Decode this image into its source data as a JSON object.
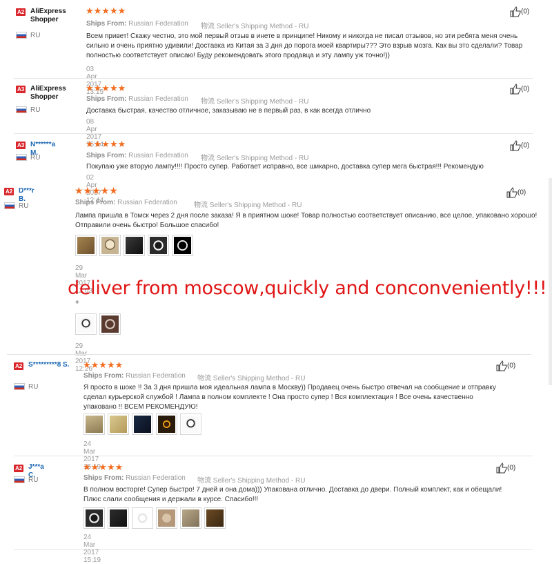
{
  "colors": {
    "badge": "#d9262c",
    "stars": "#f26b1d",
    "link": "#1a66b3",
    "overlay": "#e01616"
  },
  "ships_from_label": "Ships From:",
  "ship_icon_glyph": "物流",
  "method": "Seller's Shipping Method - RU",
  "overlay_text": "deliver from moscow,quickly and conconveniently!!!",
  "reviews": [
    {
      "badge": "A2",
      "name": "AliExpress Shopper",
      "country": "RU",
      "stars": "★★★★★",
      "ships": "Russian Federation",
      "text": "Всем привет! Скажу честно, это мой первый отзыв в инете в принципе! Никому и никогда не писал отзывов, но эти ребята меня очень сильно и очень приятно удивили! Доставка из Китая за 3 дня до порога моей квартиры??? Это взрыв мозга. Как вы это сделали? Товар полностью соответствует описаю! Буду рекомендовать этого продавца и эту лампу уж точно!))",
      "date": "03 Apr 2017 13:15",
      "helpful": "(0)"
    },
    {
      "badge": "A3",
      "name": "AliExpress Shopper",
      "country": "RU",
      "stars": "★★★★★",
      "ships": "Russian Federation",
      "text": "Доставка быстрая, качество отличное, заказываю не в первый раз, в как всегда отлично",
      "date": "08 Apr 2017 16:54",
      "helpful": "(0)"
    },
    {
      "badge": "A3",
      "name": "N******a M.",
      "country": "RU",
      "stars": "★★★★★",
      "ships": "Russian Federation",
      "text": "Покупаю уже вторую лампу!!!! Просто супер. Работает исправно, все шикарно, доставка супер мега быстрая!!! Рекомендую",
      "date": "02 Apr 2017 12:44",
      "helpful": "(0)"
    },
    {
      "badge": "A2",
      "name": "D***r B.",
      "country": "RU",
      "stars": "★★★★★",
      "ships": "Russian Federation",
      "text": "Лампа пришла в Томск через 2 дня после заказа! Я в приятном шоке! Товар полностью соответствует описанию, все целое, упаковано хорошо! Отправили очень быстро! Большое спасибо!",
      "date": "29 Mar 2017 12:03",
      "date2": "29 Mar 2017 12:26",
      "plus": "+",
      "helpful": "(0)"
    },
    {
      "badge": "A2",
      "name": "S*********8 S.",
      "country": "RU",
      "stars": "★★★★★",
      "ships": "Russian Federation",
      "text": "Я просто в шоке !! За 3 дня пришла моя идеальная лампа в Москву)) Продавец очень быстро отвечал на сообщение и отправку сделал курьерской службой ! Лампа в полном комплекте ! Она просто супер ! Вся комплектация ! Все очень качественно упаковано !! ВСЕМ РЕКОМЕНДУЮ!",
      "date": "24 Mar 2017 15:19",
      "helpful": "(0)"
    },
    {
      "badge": "A2",
      "name": "J***a C.",
      "country": "RU",
      "stars": "★★★★★",
      "ships": "Russian Federation",
      "text": "В полном восторге! Супер быстро! 7 дней и она дома))) Упакована отлично. Доставка до двери. Полный комплект, как и обещали! Плюс слали сообщения и держали в курсе. Спасибо!!!",
      "date": "24 Mar 2017 15:19",
      "helpful": "(0)"
    }
  ]
}
